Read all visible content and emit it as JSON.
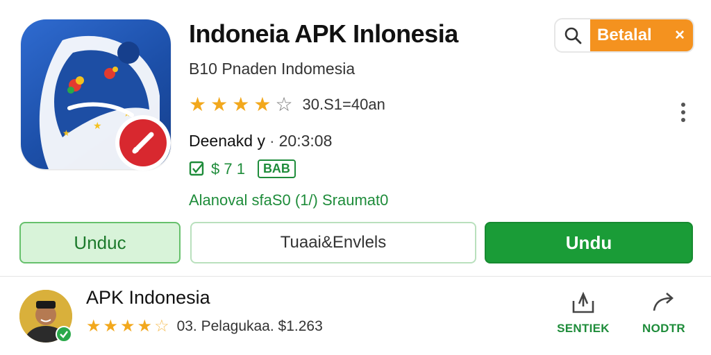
{
  "app": {
    "title": "Indoneia APK Inlonesia",
    "subtitle": "B10 Pnaden Indomesia",
    "rating_text": "30.S1=40an",
    "stars": 4,
    "developer_label": "Deenakd y",
    "developer_date": "20:3:08",
    "meta_text": "$ 7 1",
    "meta_badge": "BAB",
    "green_note": "Alanoval sfaS0 (1/) Sraumat0"
  },
  "header": {
    "detail_label": "Betalal",
    "close_glyph": "×"
  },
  "buttons": {
    "unduh_light": "Unduc",
    "middle": "Tuaai&Envlels",
    "unduh_primary": "Undu"
  },
  "publisher": {
    "name": "APK Indonesia",
    "stars": 4.5,
    "rating_text": "03. Pelagukaa. $1.263",
    "share_label": "SENTIEK",
    "forward_label": "NODTR"
  },
  "colors": {
    "accent_green": "#1a9c37",
    "accent_orange": "#f4921f",
    "star": "#f2a81d",
    "icon_blue": "#1c4fa8",
    "badge_red": "#d8282f"
  }
}
